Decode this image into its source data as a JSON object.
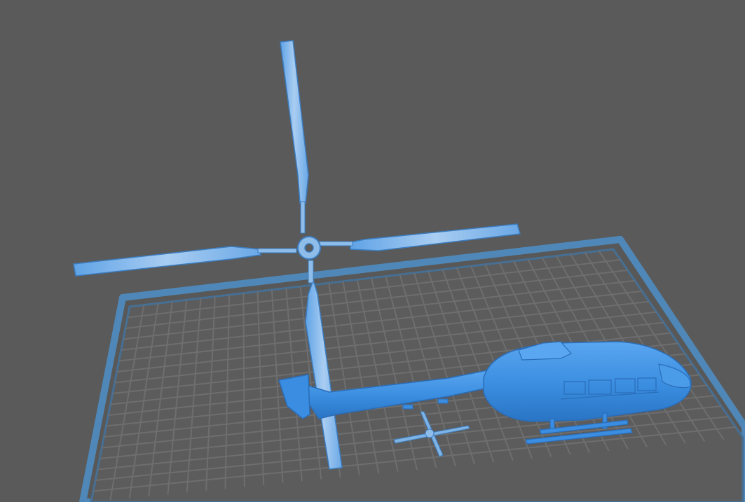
{
  "viewport": {
    "background_color": "#5a5a5a",
    "model_color": "#3d8fe0",
    "model_highlight": "#7fb8ee",
    "build_plate_color": "#4f88b8",
    "grid_line_color": "#707070"
  },
  "scene": {
    "objects": [
      {
        "id": "main-rotor",
        "kind": "four-blade main rotor"
      },
      {
        "id": "helicopter-body",
        "kind": "fuselage with skids"
      },
      {
        "id": "tail-rotor",
        "kind": "small tail rotor"
      }
    ],
    "icons": [
      "build-plate-icon",
      "helicopter-model-icon"
    ]
  }
}
